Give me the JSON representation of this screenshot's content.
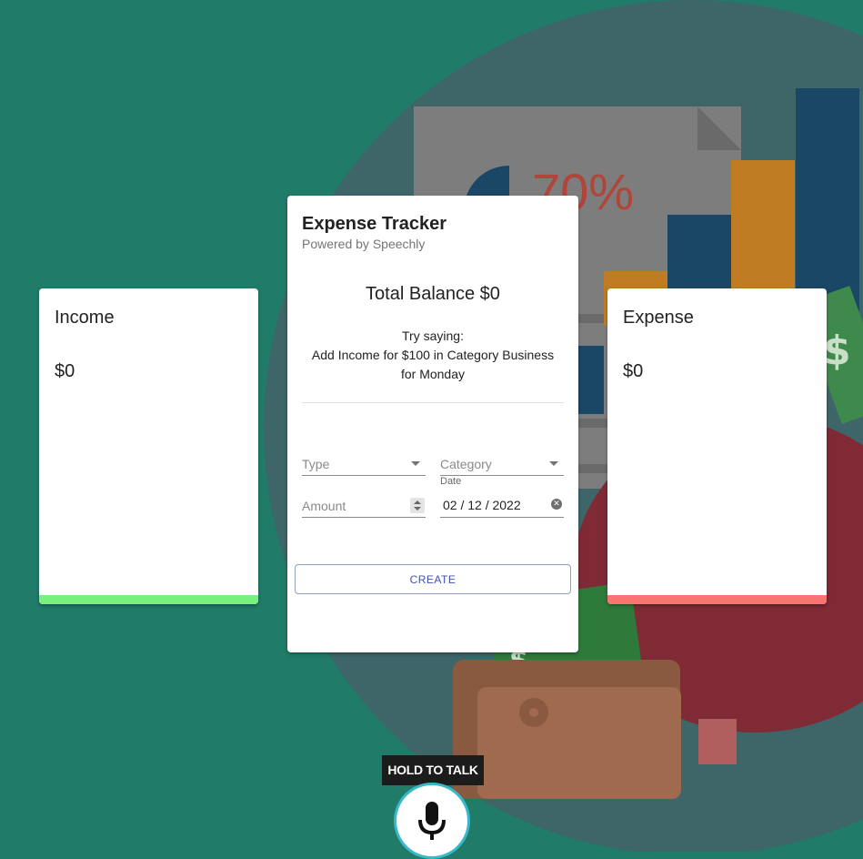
{
  "income": {
    "title": "Income",
    "amount": "$0",
    "bar_color": "#78f07e"
  },
  "expense": {
    "title": "Expense",
    "amount": "$0",
    "bar_color": "#f77470"
  },
  "tracker": {
    "title": "Expense Tracker",
    "subtitle": "Powered by Speechly",
    "balance": "Total Balance $0",
    "hint_line1": "Try saying:",
    "hint_line2": "Add Income for $100 in Category Business for Monday"
  },
  "form": {
    "type_placeholder": "Type",
    "category_placeholder": "Category",
    "amount_placeholder": "Amount",
    "date_label": "Date",
    "date_value": "02 / 12 / 2022",
    "create_label": "CREATE"
  },
  "background": {
    "chart_percent": "70%"
  },
  "voice": {
    "tooltip": "HOLD TO TALK"
  },
  "colors": {
    "page_background": "#207b68",
    "accent": "#3f51b5",
    "mic_ring": "#38b8c9"
  },
  "icons": {
    "select_caret": "caret-down-icon",
    "clear_date": "clear-icon",
    "microphone": "microphone-icon"
  }
}
